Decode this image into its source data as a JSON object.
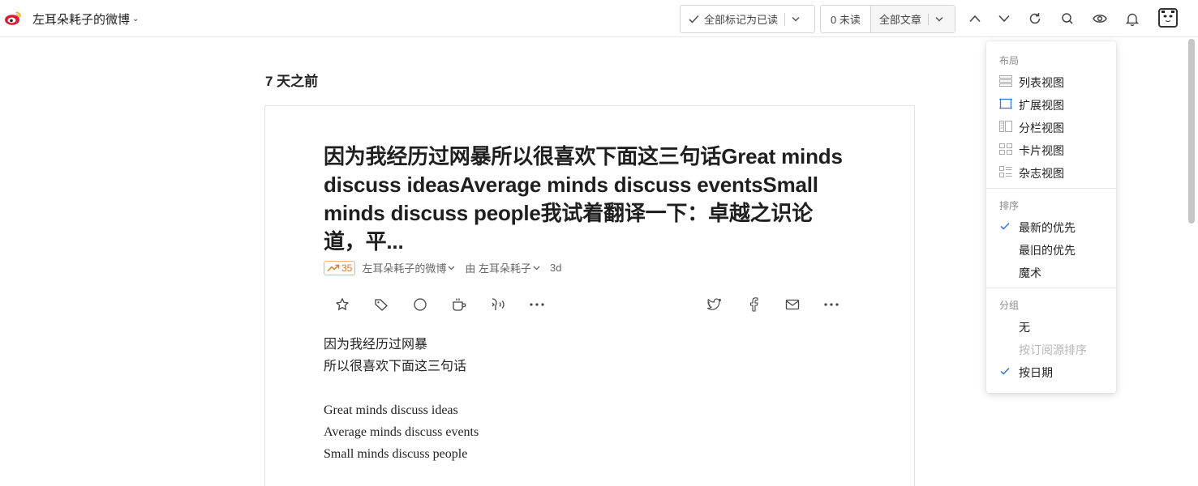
{
  "header": {
    "feed_title": "左耳朵耗子的微博",
    "mark_read_label": "全部标记为已读",
    "unread_count_label": "0 未读",
    "filter_label": "全部文章"
  },
  "main": {
    "date_heading": "7 天之前",
    "article": {
      "title": "因为我经历过网暴所以很喜欢下面这三句话Great minds discuss ideasAverage minds discuss eventsSmall minds discuss people我试着翻译一下：卓越之识论道，平...",
      "engagement_count": "35",
      "source": "左耳朵耗子的微博",
      "author": "由 左耳朵耗子",
      "age": "3d",
      "body": {
        "line1": "因为我经历过网暴",
        "line2": "所以很喜欢下面这三句话",
        "line3": "Great minds discuss ideas",
        "line4": "Average minds discuss events",
        "line5": "Small minds discuss people"
      }
    }
  },
  "menu": {
    "layout_title": "布局",
    "layout_items": [
      "列表视图",
      "扩展视图",
      "分栏视图",
      "卡片视图",
      "杂志视图"
    ],
    "sort_title": "排序",
    "sort_items": [
      "最新的优先",
      "最旧的优先",
      "魔术"
    ],
    "group_title": "分组",
    "group_items": [
      "无",
      "按订阅源排序",
      "按日期"
    ]
  },
  "colors": {
    "accent_blue": "#3a7bd5",
    "engagement_orange": "#e07b2a",
    "weibo_red": "#e6162d"
  }
}
